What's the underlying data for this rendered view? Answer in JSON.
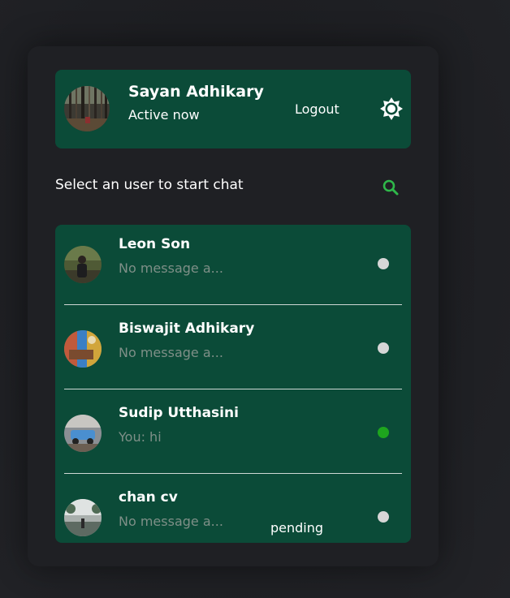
{
  "current_user": {
    "name": "Sayan Adhikary",
    "status": "Active now",
    "logout_label": "Logout",
    "settings_icon": "gear-icon"
  },
  "search": {
    "label": "Select an user to start chat",
    "icon": "search-icon"
  },
  "users": [
    {
      "name": "Leon Son",
      "message": "No message a...",
      "online": false,
      "status_color": "#d6d6d6"
    },
    {
      "name": "Biswajit Adhikary",
      "message": "No message a...",
      "online": false,
      "status_color": "#d6d6d6"
    },
    {
      "name": "Sudip Utthasini",
      "message": "You: hi",
      "online": true,
      "status_color": "#1ea51e"
    },
    {
      "name": "chan cv",
      "message": "No message a...",
      "badge": "pending",
      "online": false,
      "status_color": "#d6d6d6"
    }
  ],
  "colors": {
    "background": "#1e1f23",
    "panel": "#1f2024",
    "card": "#0b4b38",
    "accent_green": "#1ea51e"
  }
}
